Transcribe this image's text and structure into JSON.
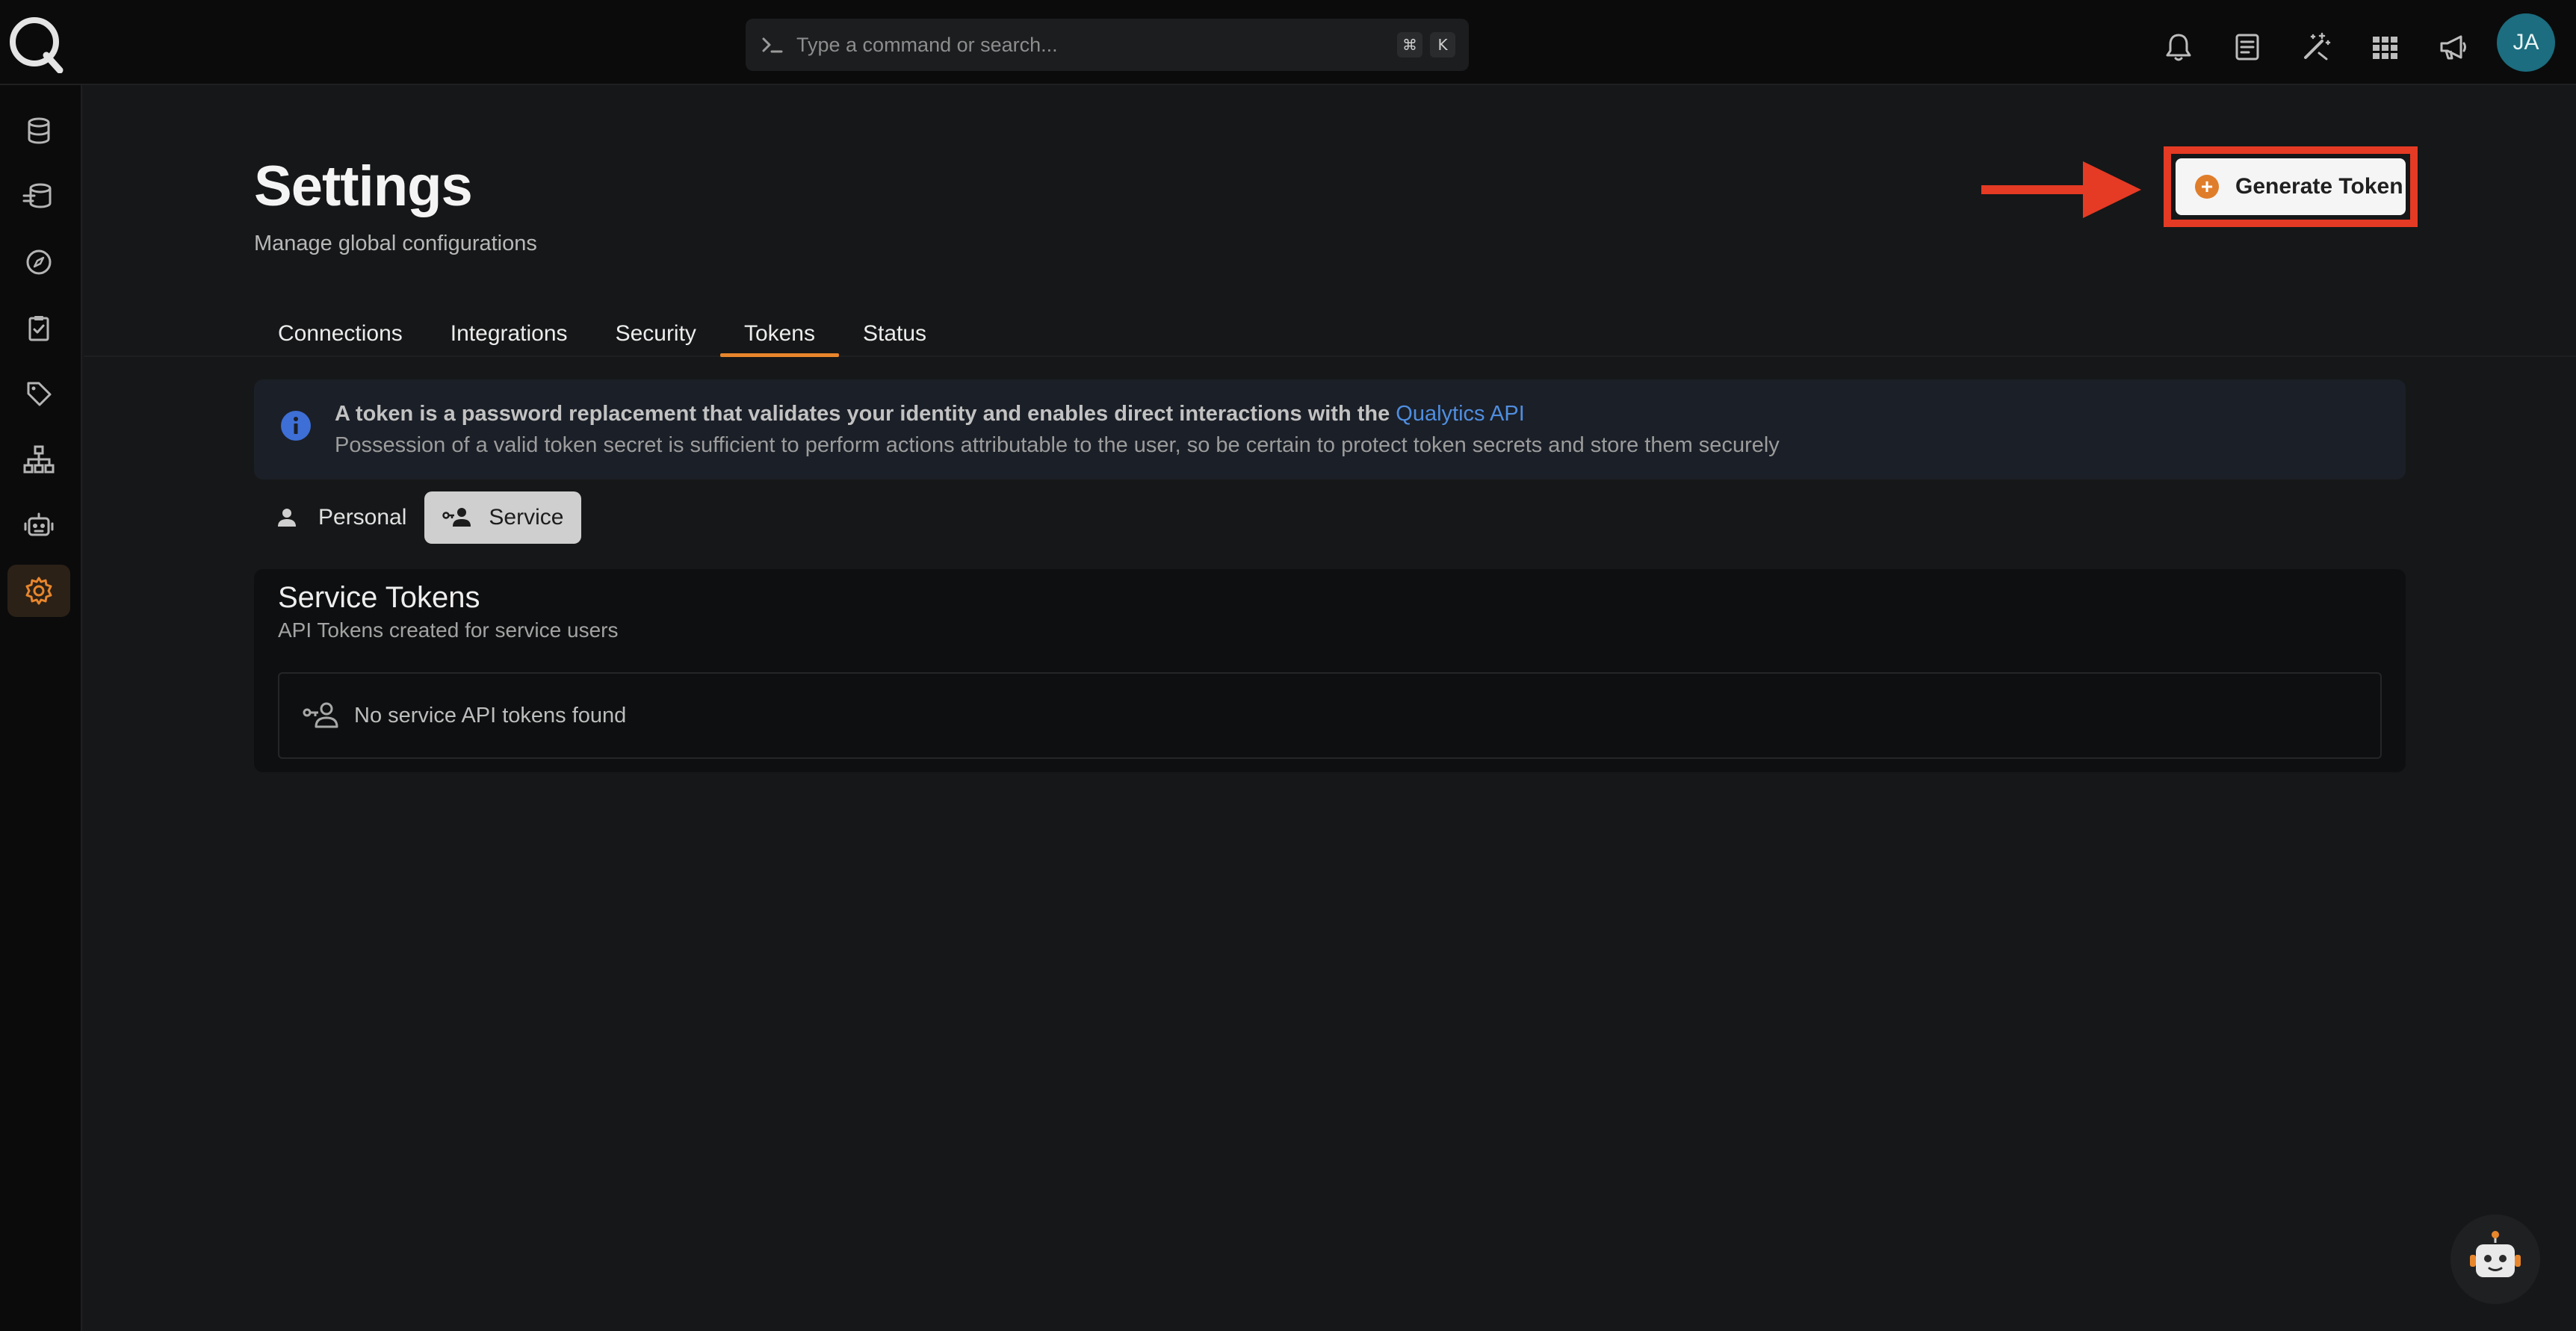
{
  "header": {
    "search_placeholder": "Type a command or search...",
    "shortcut_modifier": "⌘",
    "shortcut_key": "K",
    "avatar_initials": "JA",
    "icons": [
      "bell-icon",
      "notes-icon",
      "magic-wand-icon",
      "apps-grid-icon",
      "megaphone-icon"
    ]
  },
  "sidebar": {
    "items": [
      {
        "icon": "database-icon"
      },
      {
        "icon": "datastores-icon"
      },
      {
        "icon": "compass-icon"
      },
      {
        "icon": "clipboard-check-icon"
      },
      {
        "icon": "tag-icon"
      },
      {
        "icon": "hierarchy-icon"
      },
      {
        "icon": "robot-icon"
      },
      {
        "icon": "gear-icon",
        "active": true
      }
    ]
  },
  "page": {
    "title": "Settings",
    "subtitle": "Manage global configurations",
    "generate_button": "Generate Token"
  },
  "tabs": [
    {
      "label": "Connections"
    },
    {
      "label": "Integrations"
    },
    {
      "label": "Security"
    },
    {
      "label": "Tokens",
      "active": true
    },
    {
      "label": "Status"
    }
  ],
  "info": {
    "line1_text": "A token is a password replacement that validates your identity and enables direct interactions with the ",
    "line1_link": "Qualytics API",
    "line2": "Possession of a valid token secret is sufficient to perform actions attributable to the user, so be certain to protect token secrets and store them securely"
  },
  "token_toggle": {
    "personal": "Personal",
    "service": "Service",
    "selected": "Service"
  },
  "service_tokens": {
    "title": "Service Tokens",
    "subtitle": "API Tokens created for service users",
    "empty_message": "No service API tokens found"
  },
  "colors": {
    "accent": "#e8862c",
    "highlight": "#e53a24",
    "link": "#4f8edf",
    "avatar": "#1b6d7f"
  }
}
